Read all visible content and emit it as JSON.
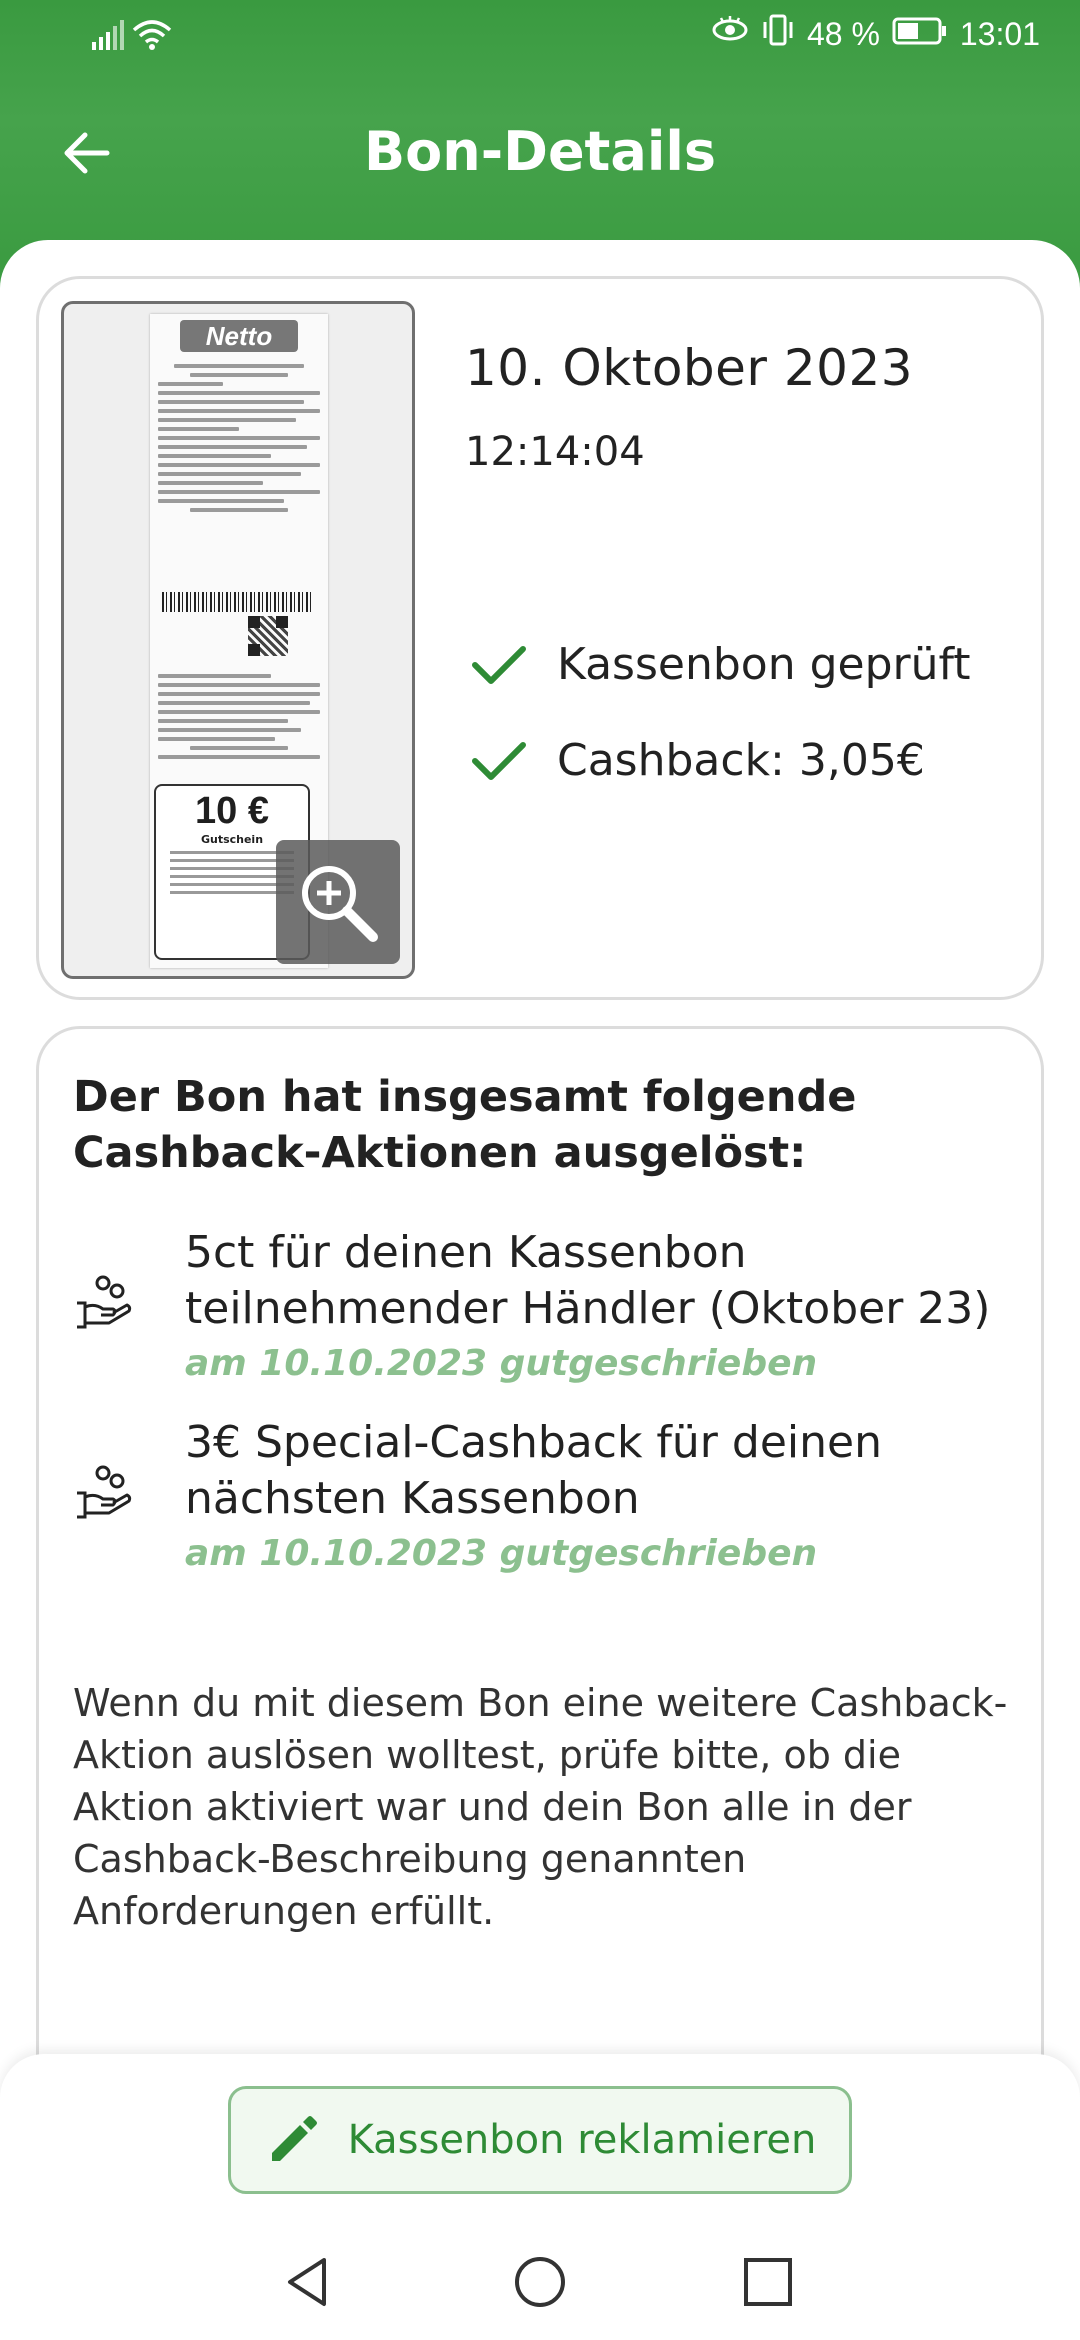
{
  "status_bar": {
    "battery_percent": "48 %",
    "time": "13:01",
    "icons": [
      "signal-icon",
      "wifi-icon",
      "eye-icon",
      "vibrate-icon",
      "battery-icon"
    ]
  },
  "app_bar": {
    "title": "Bon-Details",
    "back_icon": "arrow-left-icon"
  },
  "receipt": {
    "store_logo_text": "Netto",
    "coupon_value": "10 €",
    "coupon_label": "Gutschein",
    "date": "10. Oktober 2023",
    "time": "12:14:04",
    "checks": [
      {
        "label": "Kassenbon geprüft"
      },
      {
        "label": "Cashback: 3,05€"
      }
    ],
    "zoom_icon": "zoom-in-icon"
  },
  "actions": {
    "heading": "Der Bon hat insgesamt folgende Cashback-Aktionen ausgelöst:",
    "items": [
      {
        "title": "5ct für deinen Kassenbon teilnehmender Händler (Oktober 23)",
        "sub": "am 10.10.2023 gutgeschrieben"
      },
      {
        "title": "3€ Special-Cashback für deinen nächsten Kassenbon",
        "sub": "am 10.10.2023 gutgeschrieben"
      }
    ],
    "note": "Wenn du mit diesem Bon eine weitere Cashback-Aktion auslösen wolltest, prüfe bitte, ob die Aktion aktiviert war und dein Bon alle in der Cashback-Beschreibung genannten Anforderungen erfüllt."
  },
  "bottom": {
    "claim_label": "Kassenbon reklamieren",
    "claim_icon": "pencil-icon"
  },
  "colors": {
    "brand_green": "#3a9a40",
    "check_green": "#2e8b35",
    "sub_green": "#8cc08f"
  }
}
